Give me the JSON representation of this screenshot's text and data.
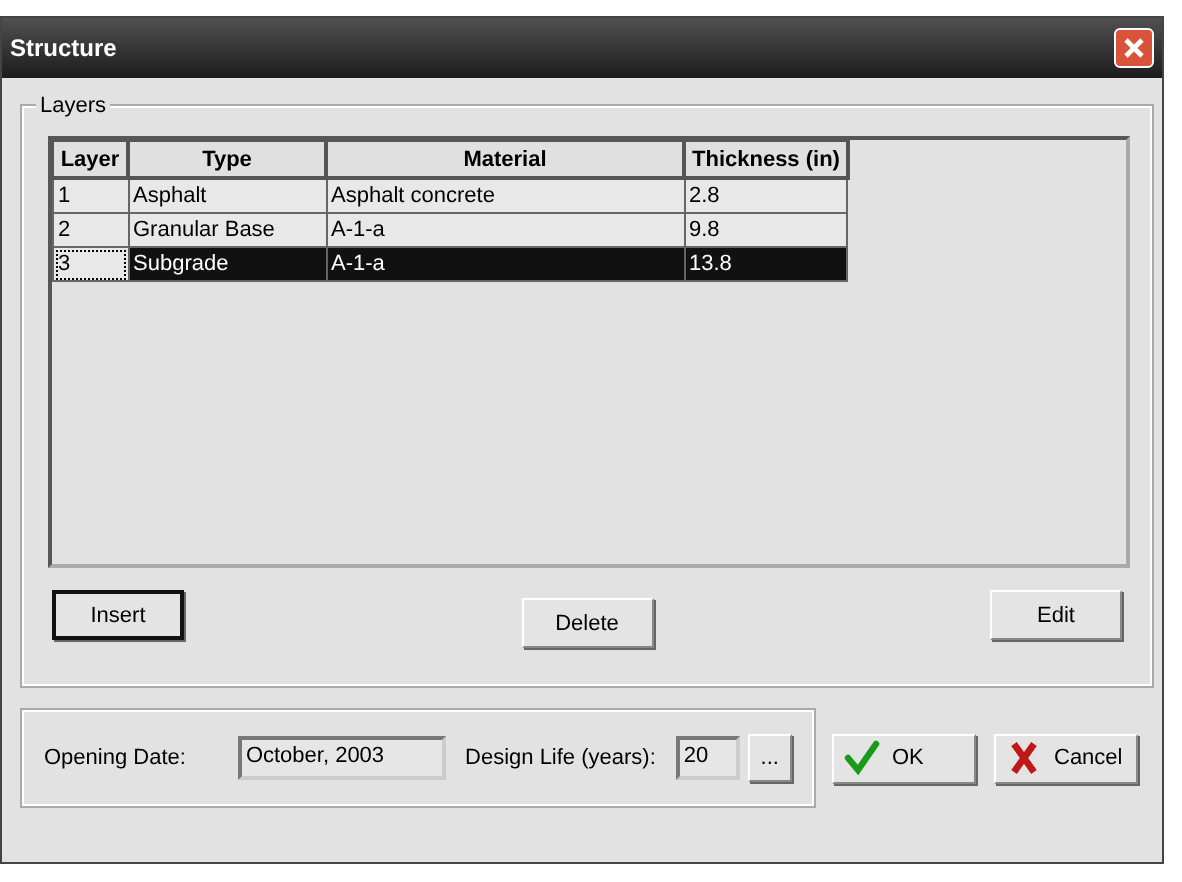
{
  "window": {
    "title": "Structure"
  },
  "layers": {
    "title": "Layers",
    "table": {
      "columns": [
        "Layer",
        "Type",
        "Material",
        "Thickness (in)"
      ],
      "rows": [
        {
          "cells": [
            "1",
            "Asphalt",
            "Asphalt concrete",
            "2.8"
          ],
          "selected": false
        },
        {
          "cells": [
            "2",
            "Granular Base",
            "A-1-a",
            "9.8"
          ],
          "selected": false
        },
        {
          "cells": [
            "3",
            "Subgrade",
            "A-1-a",
            "13.8"
          ],
          "selected": true
        }
      ]
    },
    "buttons": [
      {
        "label": "Insert",
        "focused": true
      },
      {
        "label": "Delete",
        "focused": false
      },
      {
        "label": "Edit",
        "focused": false
      }
    ]
  },
  "opening_date": {
    "label": "Opening Date:",
    "value": "October, 2003"
  },
  "design_life": {
    "label": "Design Life (years):",
    "value": "20",
    "button": "..."
  },
  "dialog_buttons": [
    {
      "kind": "ok",
      "label": "OK"
    },
    {
      "kind": "cancel",
      "label": "Cancel"
    }
  ]
}
